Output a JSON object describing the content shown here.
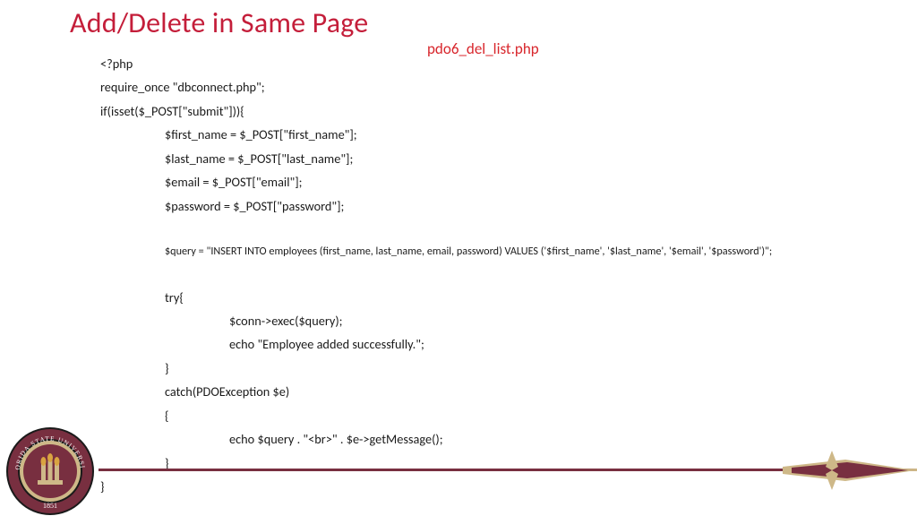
{
  "title": "Add/Delete in Same Page",
  "filename": "pdo6_del_list.php",
  "code": {
    "l1": "<?php",
    "l2": "require_once \"dbconnect.php\";",
    "l3": "if(isset($_POST[\"submit\"])){",
    "l4": "$first_name = $_POST[\"first_name\"];",
    "l5": "$last_name = $_POST[\"last_name\"];",
    "l6": "$email = $_POST[\"email\"];",
    "l7": "$password = $_POST[\"password\"];",
    "l8": "$query = \"INSERT INTO employees (first_name, last_name, email, password)  VALUES ('$first_name', '$last_name', '$email', '$password')\";",
    "l9": "try{",
    "l10": "$conn->exec($query);",
    "l11": "echo \"Employee added successfully.\";",
    "l12": "}",
    "l13": "catch(PDOException $e)",
    "l14": "{",
    "l15": "echo $query . \"<br>\" . $e->getMessage();",
    "l16": "}",
    "l17": "}"
  },
  "seal": {
    "top_text": "FLORIDA STATE UNIVERSITY",
    "year": "1851"
  }
}
